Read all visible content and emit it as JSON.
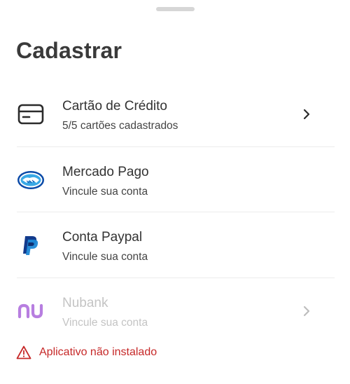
{
  "sheet": {
    "title": "Cadastrar"
  },
  "options": [
    {
      "label": "Cartão de Crédito",
      "sub": "5/5 cartões cadastrados",
      "icon": "credit-card-icon"
    },
    {
      "label": "Mercado Pago",
      "sub": "Vincule sua conta",
      "icon": "mercado-pago-logo-icon"
    },
    {
      "label": "Conta Paypal",
      "sub": "Vincule sua conta",
      "icon": "paypal-logo-icon"
    },
    {
      "label": "Nubank",
      "sub": "Vincule sua conta",
      "icon": "nubank-logo-icon"
    }
  ],
  "warning": {
    "text": "Aplicativo não instalado",
    "icon": "warning-triangle-icon"
  },
  "colors": {
    "title": "#3a3a3a",
    "text": "#333333",
    "disabled_text": "#c4c4c4",
    "divider": "#ececec",
    "warning": "#c62828",
    "nubank": "#b77ee0",
    "paypal_dark": "#123a8c",
    "paypal_light": "#1e88d6",
    "mercadopago": "#0a4aa8"
  }
}
